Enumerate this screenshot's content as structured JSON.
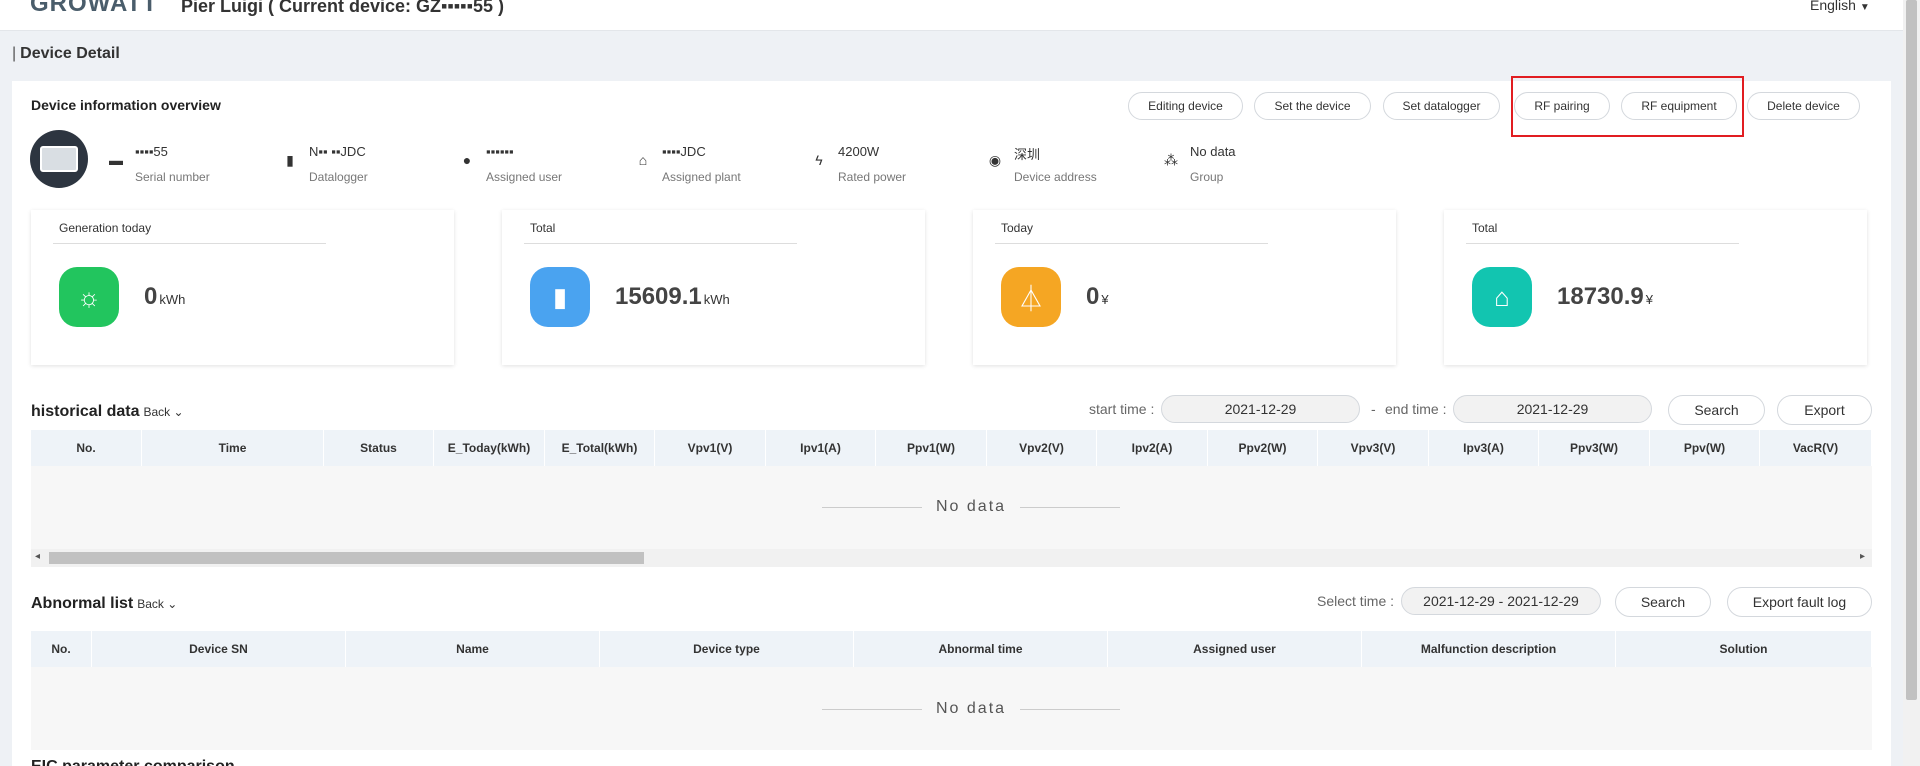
{
  "header": {
    "logo": "GROWATT",
    "title": "Pier Luigi ( Current device: GZ▪▪▪▪▪55 )",
    "language": "English"
  },
  "page_title": "Device Detail",
  "overview": {
    "title": "Device information overview",
    "actions": [
      "Editing device",
      "Set the device",
      "Set datalogger",
      "RF pairing",
      "RF equipment",
      "Delete device"
    ],
    "info": [
      {
        "icon": "inverter-icon",
        "value": "▪▪▪▪55",
        "label": "Serial number"
      },
      {
        "icon": "datalogger-icon",
        "value": "N▪▪ ▪▪JDC",
        "label": "Datalogger"
      },
      {
        "icon": "user-icon",
        "value": "▪▪▪▪▪▪",
        "label": "Assigned user"
      },
      {
        "icon": "home-icon",
        "value": "▪▪▪▪JDC",
        "label": "Assigned plant"
      },
      {
        "icon": "bolt-icon",
        "value": "4200W",
        "label": "Rated power"
      },
      {
        "icon": "location-icon",
        "value": "深圳",
        "label": "Device address"
      },
      {
        "icon": "group-icon",
        "value": "No data",
        "label": "Group"
      }
    ]
  },
  "stats": [
    {
      "label": "Generation today",
      "value": "0",
      "unit": "kWh",
      "color": "#22c55e",
      "icon": "solar-icon"
    },
    {
      "label": "Total",
      "value": "15609.1",
      "unit": "kWh",
      "color": "#4aa3f0",
      "icon": "battery-icon"
    },
    {
      "label": "Today",
      "value": "0",
      "unit": "¥",
      "color": "#f5a623",
      "icon": "tower-icon"
    },
    {
      "label": "Total",
      "value": "18730.9",
      "unit": "¥",
      "color": "#12c5b0",
      "icon": "house-icon"
    }
  ],
  "historical": {
    "title": "historical data",
    "back": "Back",
    "start_label": "start time :",
    "start_value": "2021-12-29",
    "sep": "-",
    "end_label": "end time :",
    "end_value": "2021-12-29",
    "search": "Search",
    "export": "Export",
    "columns": [
      "No.",
      "Time",
      "Status",
      "E_Today(kWh)",
      "E_Total(kWh)",
      "Vpv1(V)",
      "Ipv1(A)",
      "Ppv1(W)",
      "Vpv2(V)",
      "Ipv2(A)",
      "Ppv2(W)",
      "Vpv3(V)",
      "Ipv3(A)",
      "Ppv3(W)",
      "Ppv(W)",
      "VacR(V)"
    ],
    "empty": "No data"
  },
  "abnormal": {
    "title": "Abnormal list",
    "back": "Back",
    "select_label": "Select time :",
    "select_value": "2021-12-29 - 2021-12-29",
    "search": "Search",
    "export": "Export fault log",
    "columns": [
      "No.",
      "Device SN",
      "Name",
      "Device type",
      "Abnormal time",
      "Assigned user",
      "Malfunction description",
      "Solution"
    ],
    "empty": "No data"
  },
  "eic": {
    "title": "EIC parameter comparison"
  },
  "colors": {
    "highlight": "#e11d21",
    "table_header": "#eef3f8"
  }
}
